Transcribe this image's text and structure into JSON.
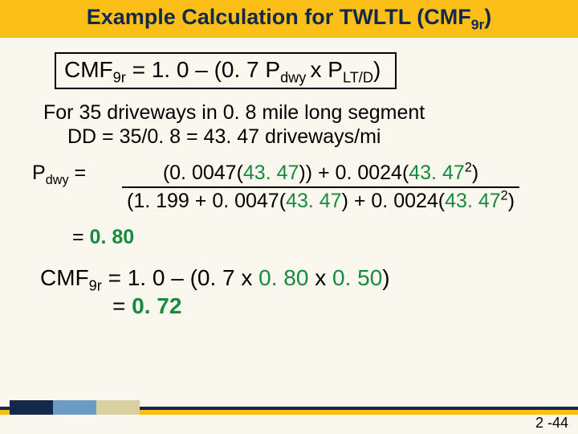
{
  "title": {
    "prefix": "Example Calculation for TWLTL (CMF",
    "sub": "9r",
    "suffix": ")"
  },
  "formula": {
    "lhs_prefix": "CMF",
    "lhs_sub": "9r",
    "eq": " = 1. 0 – (0. 7 P",
    "sub2": "dwy ",
    "mid": "x P",
    "sub3": "LT/D",
    "suffix": ")"
  },
  "context": {
    "line1": "For 35 driveways in 0. 8 mile long segment",
    "line2": "DD = 35/0. 8  = 43. 47 driveways/mi"
  },
  "pdwy": {
    "label_prefix": "P",
    "label_sub": "dwy",
    "label_suffix": " =",
    "num_a": "(0. 0047(",
    "num_hl1": "43. 47",
    "num_b": ")) + 0. 0024(",
    "num_hl2": "43. 47",
    "num_sup1": "2",
    "num_c": ")",
    "den_a": "(1. 199 + 0. 0047(",
    "den_hl1": "43. 47",
    "den_b": ") + 0. 0024(",
    "den_hl2": "43. 47",
    "den_sup1": "2",
    "den_c": ")"
  },
  "result1": {
    "prefix": "= ",
    "value": "0. 80"
  },
  "cmf_final": {
    "line1_a": "CMF",
    "line1_sub": "9r",
    "line1_b": " = 1. 0 – (0. 7 x ",
    "line1_hl1": "0. 80",
    "line1_c": " x ",
    "line1_hl2": "0. 50",
    "line1_d": ")",
    "line2_a": "= ",
    "line2_hl": "0. 72"
  },
  "page_number": "2 -44"
}
